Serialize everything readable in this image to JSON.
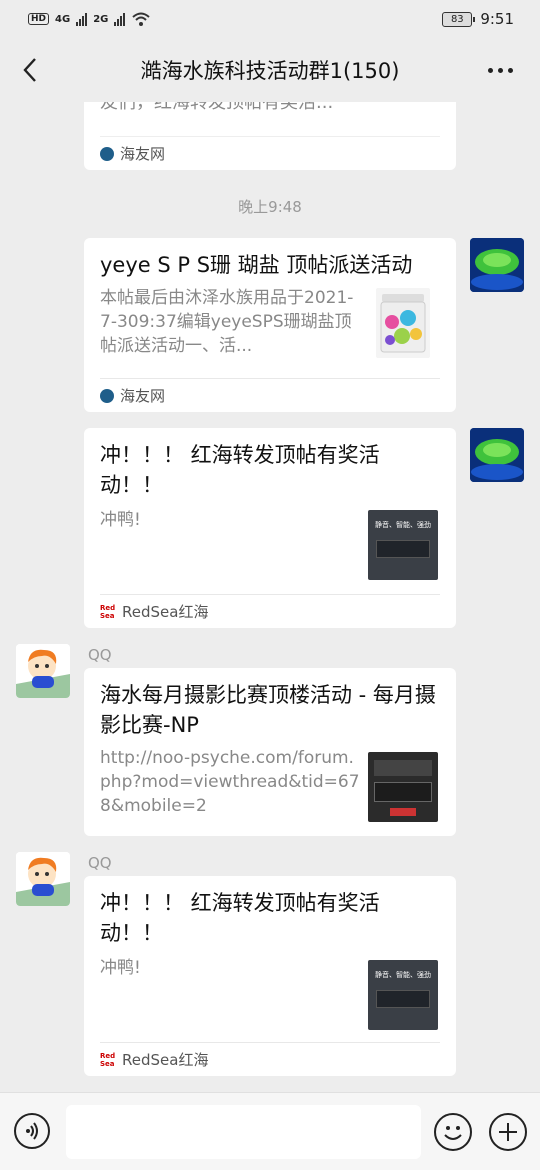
{
  "status": {
    "net": "4G",
    "net2": "2G",
    "hd": "HD",
    "battery": "83",
    "time": "9:51"
  },
  "header": {
    "title": "澔海水族科技活动群1(150)"
  },
  "messages": [
    {
      "partial_desc": "友们，红海转发顶帖有奖活...",
      "source": "海友网"
    },
    {
      "timestamp": "晚上9:48"
    },
    {
      "title": "yeye S P S珊 瑚盐 顶帖派送活动",
      "desc": "本帖最后由沐泽水族用品于2021-7-309:37编辑yeyeSPS珊瑚盐顶帖派送活动一、活...",
      "source": "海友网"
    },
    {
      "title": "冲！！！ 红海转发顶帖有奖活动！！",
      "desc": "冲鸭!",
      "source": "RedSea红海"
    },
    {
      "sender": "QQ",
      "title": "海水每月摄影比赛顶楼活动 - 每月摄影比赛-NP",
      "desc": "http://noo-psyche.com/forum.php?mod=viewthread&tid=678&mobile=2"
    },
    {
      "sender": "QQ",
      "title": "冲！！！ 红海转发顶帖有奖活动！！",
      "desc": "冲鸭!",
      "source": "RedSea红海"
    }
  ],
  "thumb_text": {
    "redsea": "静音、智能、强劲"
  },
  "input": {
    "placeholder": ""
  },
  "icons": {
    "back": "back-arrow-icon",
    "more": "more-dots-icon",
    "voice": "voice-icon",
    "emoji": "emoji-icon",
    "plus": "plus-icon"
  },
  "colors": {
    "background": "#ededed",
    "card": "#ffffff",
    "muted": "#888888"
  }
}
